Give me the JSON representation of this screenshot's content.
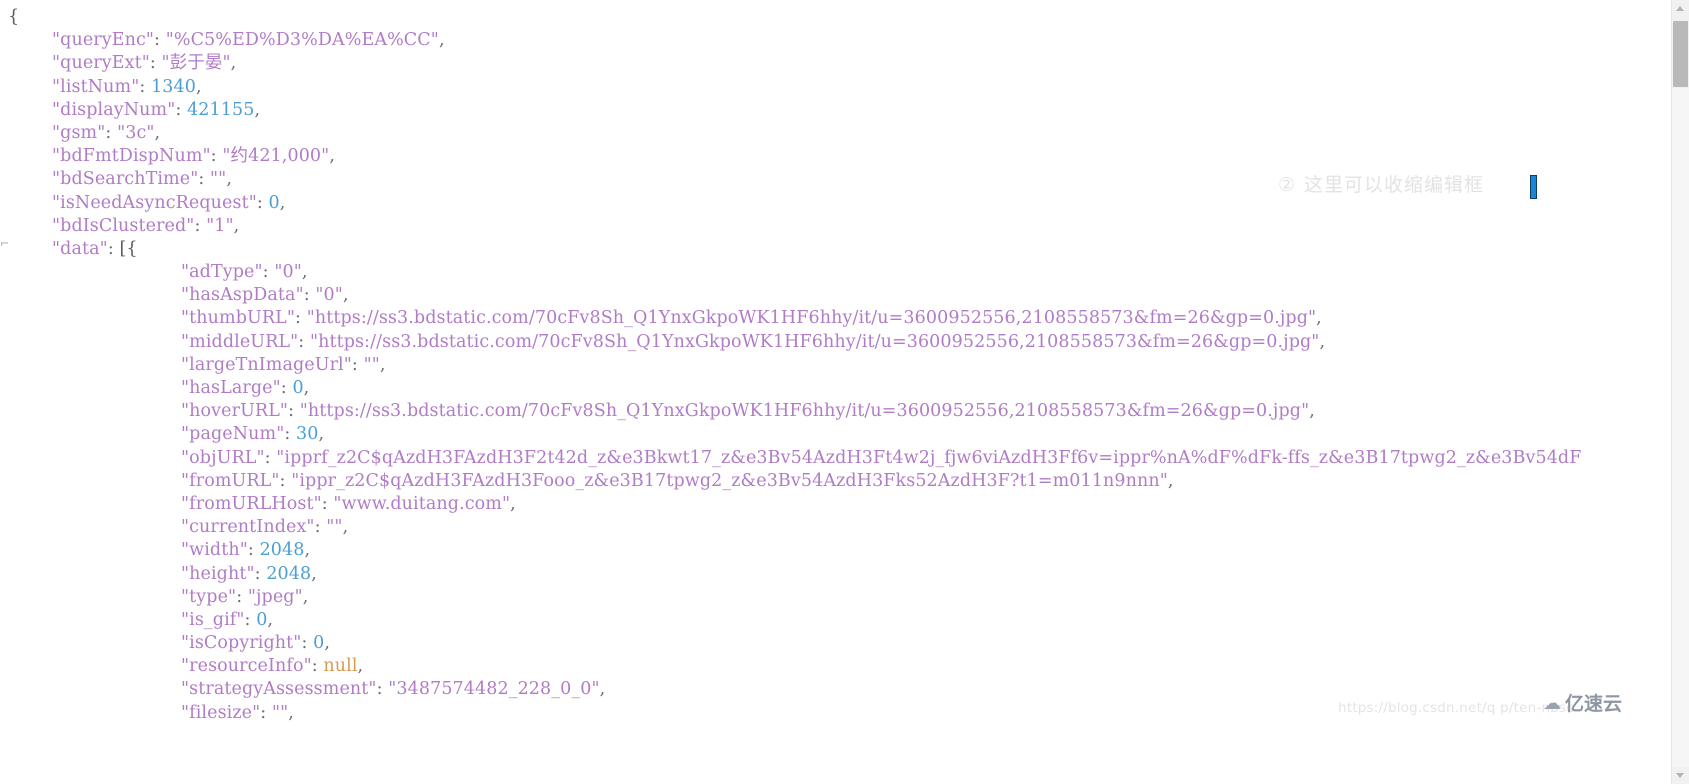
{
  "app": {
    "kind": "json-viewer",
    "background": "#ffffff"
  },
  "colors": {
    "string": "#b07cc6",
    "number": "#4a9fd4",
    "null": "#d99b52",
    "punctuation": "#5b5b66",
    "caret": "#1a84d6",
    "scrollbar_thumb": "#b9b9b9",
    "annotation": "#e3e3e6"
  },
  "code": {
    "lines": [
      {
        "indent": 0,
        "text": "{"
      },
      {
        "indent": 1,
        "text": "\"queryEnc\": \"%C5%ED%D3%DA%EA%CC\","
      },
      {
        "indent": 1,
        "text": "\"queryExt\": \"彭于晏\","
      },
      {
        "indent": 1,
        "text": "\"listNum\": 1340,"
      },
      {
        "indent": 1,
        "text": "\"displayNum\": 421155,"
      },
      {
        "indent": 1,
        "text": "\"gsm\": \"3c\","
      },
      {
        "indent": 1,
        "text": "\"bdFmtDispNum\": \"约421,000\","
      },
      {
        "indent": 1,
        "text": "\"bdSearchTime\": \"\","
      },
      {
        "indent": 1,
        "text": "\"isNeedAsyncRequest\": 0,"
      },
      {
        "indent": 1,
        "text": "\"bdIsClustered\": \"1\","
      },
      {
        "indent": 1,
        "text": "\"data\": [{"
      },
      {
        "indent": 2,
        "text": "\"adType\": \"0\","
      },
      {
        "indent": 2,
        "text": "\"hasAspData\": \"0\","
      },
      {
        "indent": 2,
        "text": "\"thumbURL\": \"https://ss3.bdstatic.com/70cFv8Sh_Q1YnxGkpoWK1HF6hhy/it/u=3600952556,2108558573&fm=26&gp=0.jpg\","
      },
      {
        "indent": 2,
        "text": "\"middleURL\": \"https://ss3.bdstatic.com/70cFv8Sh_Q1YnxGkpoWK1HF6hhy/it/u=3600952556,2108558573&fm=26&gp=0.jpg\","
      },
      {
        "indent": 2,
        "text": "\"largeTnImageUrl\": \"\","
      },
      {
        "indent": 2,
        "text": "\"hasLarge\": 0,"
      },
      {
        "indent": 2,
        "text": "\"hoverURL\": \"https://ss3.bdstatic.com/70cFv8Sh_Q1YnxGkpoWK1HF6hhy/it/u=3600952556,2108558573&fm=26&gp=0.jpg\","
      },
      {
        "indent": 2,
        "text": "\"pageNum\": 30,"
      },
      {
        "indent": 2,
        "text": "\"objURL\": \"ipprf_z2C$qAzdH3FAzdH3F2t42d_z&e3Bkwt17_z&e3Bv54AzdH3Ft4w2j_fjw6viAzdH3Ff6v=ippr%nA%dF%dFk-ffs_z&e3B17tpwg2_z&e3Bv54dF"
      },
      {
        "indent": 2,
        "text": "\"fromURL\": \"ippr_z2C$qAzdH3FAzdH3Fooo_z&e3B17tpwg2_z&e3Bv54AzdH3Fks52AzdH3F?t1=m011n9nnn\","
      },
      {
        "indent": 2,
        "text": "\"fromURLHost\": \"www.duitang.com\","
      },
      {
        "indent": 2,
        "text": "\"currentIndex\": \"\","
      },
      {
        "indent": 2,
        "text": "\"width\": 2048,"
      },
      {
        "indent": 2,
        "text": "\"height\": 2048,"
      },
      {
        "indent": 2,
        "text": "\"type\": \"jpeg\","
      },
      {
        "indent": 2,
        "text": "\"is_gif\": 0,"
      },
      {
        "indent": 2,
        "text": "\"isCopyright\": 0,"
      },
      {
        "indent": 2,
        "text": "\"resourceInfo\": null,"
      },
      {
        "indent": 2,
        "text": "\"strategyAssessment\": \"3487574482_228_0_0\","
      },
      {
        "indent": 2,
        "text": "\"filesize\": \"\","
      }
    ]
  },
  "annotation": {
    "marker": "②",
    "text": "这里可以收缩编辑框"
  },
  "gutter": {
    "fold_marker": "⌐"
  },
  "scrollbar": {
    "up_arrow": "scroll-up-arrow",
    "down_arrow": "scroll-down-arrow"
  },
  "watermarks": {
    "blog_url": "https://blog.csdn.net/q p/ten-nbsc",
    "brand_name": "亿速云",
    "brand_glyph": "☁"
  }
}
